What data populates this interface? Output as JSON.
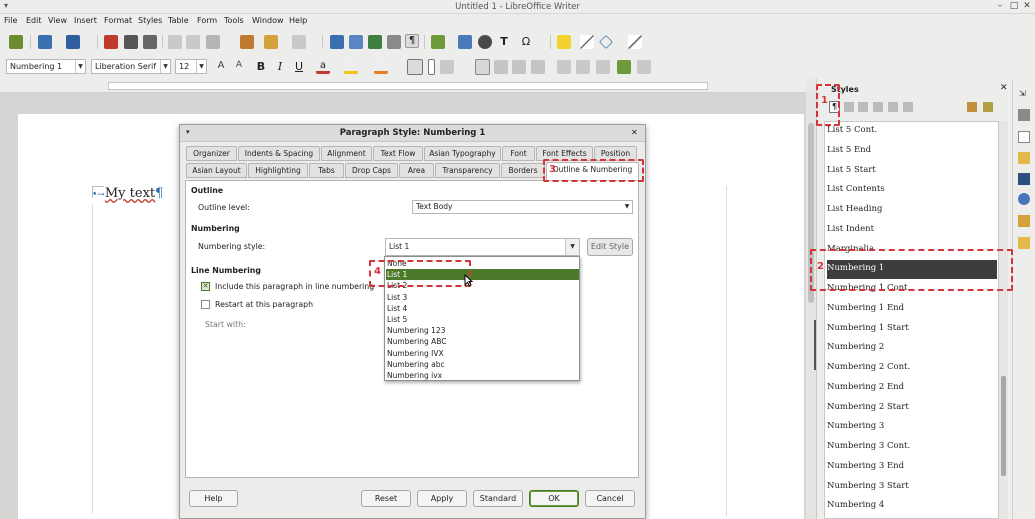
{
  "window": {
    "title": "Untitled 1 - LibreOffice Writer"
  },
  "menubar": [
    "File",
    "Edit",
    "View",
    "Insert",
    "Format",
    "Styles",
    "Table",
    "Form",
    "Tools",
    "Window",
    "Help"
  ],
  "formatting": {
    "paragraph_style": "Numbering 1",
    "font_name": "Liberation Serif",
    "font_size": "12",
    "bold": "B",
    "italic": "I",
    "underline": "U"
  },
  "document": {
    "text": "My text"
  },
  "sidebar": {
    "title": "Styles",
    "styles": [
      "List 5 Cont.",
      "List 5 End",
      "List 5 Start",
      "List Contents",
      "List Heading",
      "List Indent",
      "Marginalia",
      "Numbering 1",
      "Numbering 1 Cont.",
      "Numbering 1 End",
      "Numbering 1 Start",
      "Numbering 2",
      "Numbering 2 Cont.",
      "Numbering 2 End",
      "Numbering 2 Start",
      "Numbering 3",
      "Numbering 3 Cont.",
      "Numbering 3 End",
      "Numbering 3 Start",
      "Numbering 4"
    ],
    "selected": "Numbering 1"
  },
  "dialog": {
    "title": "Paragraph Style: Numbering 1",
    "tabs_row1": [
      "Organizer",
      "Indents & Spacing",
      "Alignment",
      "Text Flow",
      "Asian Typography",
      "Font",
      "Font Effects",
      "Position"
    ],
    "tabs_row2": [
      "Asian Layout",
      "Highlighting",
      "Tabs",
      "Drop Caps",
      "Area",
      "Transparency",
      "Borders",
      "Outline & Numbering"
    ],
    "active_tab": "Outline & Numbering",
    "outline": {
      "heading": "Outline",
      "level_label": "Outline level:",
      "level_value": "Text Body"
    },
    "numbering": {
      "heading": "Numbering",
      "style_label": "Numbering style:",
      "style_value": "List 1",
      "edit_style": "Edit Style",
      "options": [
        "None",
        "List 1",
        "List 2",
        "List 3",
        "List 4",
        "List 5",
        "Numbering 123",
        "Numbering ABC",
        "Numbering IVX",
        "Numbering abc",
        "Numbering ivx"
      ],
      "highlighted": "List 1"
    },
    "line_numbering": {
      "heading": "Line Numbering",
      "include": "Include this paragraph in line numbering",
      "include_checked": true,
      "restart": "Restart at this paragraph",
      "restart_checked": false,
      "start_with": "Start with:"
    },
    "buttons": {
      "help": "Help",
      "reset": "Reset",
      "apply": "Apply",
      "standard": "Standard",
      "ok": "OK",
      "cancel": "Cancel"
    }
  },
  "annotations": [
    "1",
    "2",
    "3",
    "4"
  ],
  "colors": {
    "annotation": "#d6343b",
    "selection_green": "#4d7a2a",
    "sidebar_selection": "#3d3d3d"
  }
}
